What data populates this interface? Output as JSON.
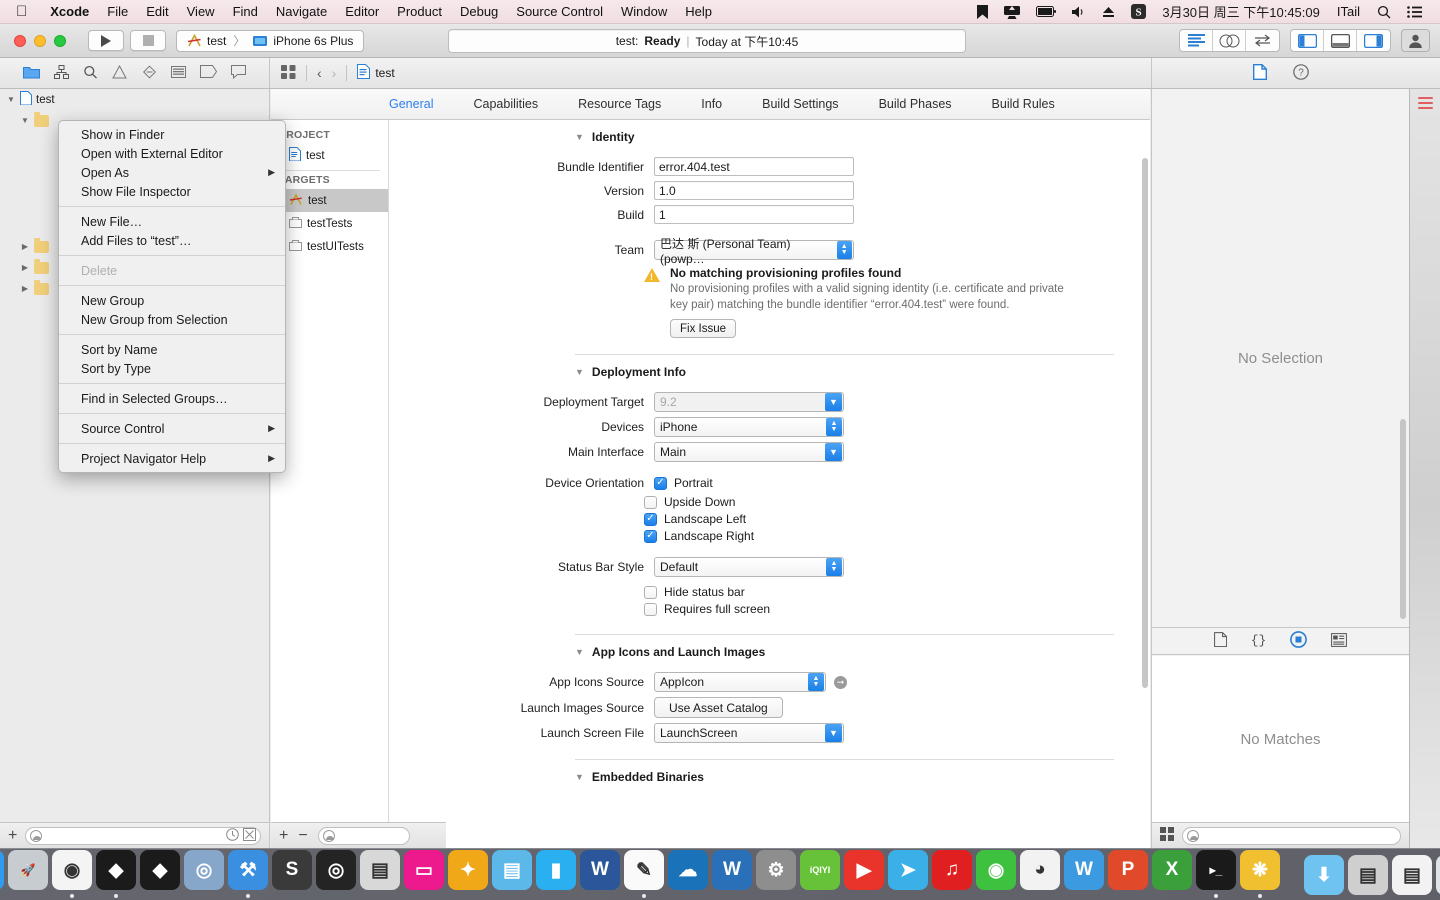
{
  "menubar": {
    "apple": "apple-logo",
    "items": [
      "Xcode",
      "File",
      "Edit",
      "View",
      "Find",
      "Navigate",
      "Editor",
      "Product",
      "Debug",
      "Source Control",
      "Window",
      "Help"
    ],
    "app_name": "Xcode",
    "status_icons": [
      "bookmark-icon",
      "screen-share-icon",
      "battery-icon",
      "volume-icon",
      "eject-icon"
    ],
    "input_method": "S",
    "clock": "3月30日 周三 下午10:45:09",
    "user": "ITail",
    "search_icon": "search-icon",
    "notification_icon": "notification-center-icon"
  },
  "toolbar": {
    "run_label": "run-button",
    "stop_label": "stop-button",
    "scheme_name": "test",
    "scheme_separator": "〉",
    "destination": "iPhone 6s Plus",
    "status_project": "test:",
    "status_state": "Ready",
    "status_divider": "|",
    "status_time": "Today at 下午10:45",
    "editor_modes": [
      "standard-editor",
      "assistant-editor",
      "version-editor"
    ],
    "view_toggles": [
      "navigator-toggle",
      "debug-area-toggle",
      "utilities-toggle"
    ],
    "account_icon": "person-icon"
  },
  "navigator_toolbar": {
    "icons": [
      "project-navigator-icon",
      "symbol-navigator-icon",
      "find-navigator-icon",
      "issue-navigator-icon",
      "test-navigator-icon",
      "debug-navigator-icon",
      "breakpoint-navigator-icon",
      "report-navigator-icon"
    ]
  },
  "jumpbar": {
    "grid_icon": "related-items-icon",
    "back": "‹",
    "forward": "›",
    "crumb_icon": "project-file-icon",
    "crumb": "test"
  },
  "inspector_tabs": {
    "items": [
      "file-inspector-icon",
      "quick-help-icon"
    ],
    "selected": 0
  },
  "navigator": {
    "rows": [
      {
        "indent": 0,
        "caret": "▼",
        "icon": "project-file-icon",
        "label": "test"
      },
      {
        "indent": 1,
        "caret": "▼",
        "icon": "folder-yellow-icon",
        "label": ""
      },
      {
        "indent": 2,
        "caret": "",
        "icon": "",
        "label": ""
      },
      {
        "indent": 2,
        "caret": "",
        "icon": "",
        "label": ""
      },
      {
        "indent": 2,
        "caret": "",
        "icon": "",
        "label": ""
      },
      {
        "indent": 2,
        "caret": "",
        "icon": "",
        "label": ""
      },
      {
        "indent": 2,
        "caret": "",
        "icon": "",
        "label": ""
      },
      {
        "indent": 1,
        "caret": "▶",
        "icon": "folder-yellow-icon",
        "label": ""
      },
      {
        "indent": 1,
        "caret": "▶",
        "icon": "folder-yellow-icon",
        "label": ""
      },
      {
        "indent": 1,
        "caret": "▶",
        "icon": "folder-yellow-icon",
        "label": ""
      }
    ],
    "filter_placeholder": "",
    "add_label": "+",
    "history_icon": "recent-files-icon",
    "filter_icon": "filter-icon"
  },
  "context_menu": {
    "groups": [
      [
        {
          "label": "Show in Finder",
          "submenu": false,
          "disabled": false
        },
        {
          "label": "Open with External Editor",
          "submenu": false,
          "disabled": false
        },
        {
          "label": "Open As",
          "submenu": true,
          "disabled": false
        },
        {
          "label": "Show File Inspector",
          "submenu": false,
          "disabled": false
        }
      ],
      [
        {
          "label": "New File…",
          "submenu": false,
          "disabled": false
        },
        {
          "label": "Add Files to “test”…",
          "submenu": false,
          "disabled": false
        }
      ],
      [
        {
          "label": "Delete",
          "submenu": false,
          "disabled": true
        }
      ],
      [
        {
          "label": "New Group",
          "submenu": false,
          "disabled": false
        },
        {
          "label": "New Group from Selection",
          "submenu": false,
          "disabled": false
        }
      ],
      [
        {
          "label": "Sort by Name",
          "submenu": false,
          "disabled": false
        },
        {
          "label": "Sort by Type",
          "submenu": false,
          "disabled": false
        }
      ],
      [
        {
          "label": "Find in Selected Groups…",
          "submenu": false,
          "disabled": false
        }
      ],
      [
        {
          "label": "Source Control",
          "submenu": true,
          "disabled": false
        }
      ],
      [
        {
          "label": "Project Navigator Help",
          "submenu": true,
          "disabled": false
        }
      ]
    ]
  },
  "editor": {
    "tabs": [
      {
        "label": "General",
        "active": true
      },
      {
        "label": "Capabilities",
        "active": false
      },
      {
        "label": "Resource Tags",
        "active": false
      },
      {
        "label": "Info",
        "active": false
      },
      {
        "label": "Build Settings",
        "active": false
      },
      {
        "label": "Build Phases",
        "active": false
      },
      {
        "label": "Build Rules",
        "active": false
      }
    ],
    "project_header": "PROJECT",
    "project_item": "test",
    "targets_header": "TARGETS",
    "targets": [
      {
        "label": "test",
        "icon": "app-target-icon",
        "selected": true
      },
      {
        "label": "testTests",
        "icon": "test-bundle-icon",
        "selected": false
      },
      {
        "label": "testUITests",
        "icon": "test-bundle-icon",
        "selected": false
      }
    ],
    "add_label": "+",
    "remove_label": "−",
    "filter_placeholder": ""
  },
  "identity": {
    "title": "Identity",
    "bundle_identifier_label": "Bundle Identifier",
    "bundle_identifier": "error.404.test",
    "version_label": "Version",
    "version": "1.0",
    "build_label": "Build",
    "build": "1",
    "team_label": "Team",
    "team": "巴达 斯 (Personal Team) (powp…"
  },
  "warning": {
    "title": "No matching provisioning profiles found",
    "body": "No provisioning profiles with a valid signing identity (i.e. certificate and private key pair) matching the bundle identifier “error.404.test” were found.",
    "fix_button": "Fix Issue",
    "icon": "warning-triangle-icon"
  },
  "deployment": {
    "title": "Deployment Info",
    "deployment_target_label": "Deployment Target",
    "deployment_target": "9.2",
    "devices_label": "Devices",
    "devices": "iPhone",
    "main_interface_label": "Main Interface",
    "main_interface": "Main",
    "device_orientation_label": "Device Orientation",
    "orientations": [
      {
        "label": "Portrait",
        "checked": true
      },
      {
        "label": "Upside Down",
        "checked": false
      },
      {
        "label": "Landscape Left",
        "checked": true
      },
      {
        "label": "Landscape Right",
        "checked": true
      }
    ],
    "status_bar_style_label": "Status Bar Style",
    "status_bar_style": "Default",
    "extra_checks": [
      {
        "label": "Hide status bar",
        "checked": false
      },
      {
        "label": "Requires full screen",
        "checked": false
      }
    ]
  },
  "app_icons": {
    "title": "App Icons and Launch Images",
    "app_icons_source_label": "App Icons Source",
    "app_icons_source": "AppIcon",
    "launch_images_source_label": "Launch Images Source",
    "launch_images_button": "Use Asset Catalog",
    "launch_screen_file_label": "Launch Screen File",
    "launch_screen_file": "LaunchScreen",
    "goto_icon": "arrow-right-circle-icon"
  },
  "embedded": {
    "title": "Embedded Binaries"
  },
  "utilities": {
    "inspector_empty": "No Selection",
    "library_tabs": [
      "file-template-library-icon",
      "code-snippet-library-icon",
      "object-library-icon",
      "media-library-icon"
    ],
    "library_selected": 2,
    "library_empty": "No Matches",
    "filter_placeholder": "",
    "grid_icon": "library-grid-icon"
  },
  "dock": {
    "items": [
      {
        "name": "finder",
        "label": "☺",
        "bg": "#2e9cf0",
        "running": true
      },
      {
        "name": "launchpad",
        "label": "🚀",
        "bg": "#c7ccd1",
        "running": false
      },
      {
        "name": "google-chrome",
        "label": "◉",
        "bg": "#f4f4f4",
        "running": true
      },
      {
        "name": "unity",
        "label": "◆",
        "bg": "#1b1b1b",
        "running": true
      },
      {
        "name": "unity-hub",
        "label": "◆",
        "bg": "#1b1b1b",
        "running": false
      },
      {
        "name": "rider",
        "label": "◎",
        "bg": "#86a7c9",
        "running": false
      },
      {
        "name": "xcode",
        "label": "⚒",
        "bg": "#3b8fe0",
        "running": true
      },
      {
        "name": "sublime-text",
        "label": "S",
        "bg": "#3a3a3a",
        "running": false
      },
      {
        "name": "photo-booth",
        "label": "◎",
        "bg": "#242424",
        "running": false
      },
      {
        "name": "image-capture",
        "label": "▤",
        "bg": "#d8d8d8",
        "running": false
      },
      {
        "name": "display",
        "label": "▭",
        "bg": "#ec1a8d",
        "running": false
      },
      {
        "name": "butterfly-app",
        "label": "✦",
        "bg": "#f0a818",
        "running": false
      },
      {
        "name": "keynote",
        "label": "▤",
        "bg": "#5bb8e8",
        "running": false
      },
      {
        "name": "ibooks",
        "label": "▮",
        "bg": "#2ab0f0",
        "running": false
      },
      {
        "name": "microsoft-word",
        "label": "W",
        "bg": "#2b579a",
        "running": false
      },
      {
        "name": "notes",
        "label": "✎",
        "bg": "#fafafa",
        "running": true
      },
      {
        "name": "openoffice",
        "label": "☁",
        "bg": "#1a72b8",
        "running": false
      },
      {
        "name": "wps-writer",
        "label": "W",
        "bg": "#2a70b8",
        "running": false
      },
      {
        "name": "system-preferences",
        "label": "⚙",
        "bg": "#8e8e8e",
        "running": false
      },
      {
        "name": "iqiyi",
        "label": "iQIYI",
        "bg": "#67c23a",
        "running": false
      },
      {
        "name": "media-player",
        "label": "▶",
        "bg": "#e8342b",
        "running": false
      },
      {
        "name": "hummingbird-app",
        "label": "➤",
        "bg": "#3bb0e8",
        "running": false
      },
      {
        "name": "netease-music",
        "label": "♫",
        "bg": "#e02020",
        "running": false
      },
      {
        "name": "wechat",
        "label": "◉",
        "bg": "#3ec13e",
        "running": false
      },
      {
        "name": "qq",
        "label": "◕",
        "bg": "#f2f2f2",
        "running": false
      },
      {
        "name": "wps-w",
        "label": "W",
        "bg": "#3b9ae0",
        "running": false
      },
      {
        "name": "wps-presentation",
        "label": "P",
        "bg": "#e04a2a",
        "running": false
      },
      {
        "name": "wps-spreadsheet",
        "label": "X",
        "bg": "#3ba03b",
        "running": false
      },
      {
        "name": "terminal",
        "label": "▸_",
        "bg": "#1a1a1a",
        "running": true
      },
      {
        "name": "color-wheel-app",
        "label": "❋",
        "bg": "#f0c030",
        "running": true
      }
    ],
    "right_items": [
      {
        "name": "downloads-folder",
        "label": "⬇",
        "bg": "#6fc3f0"
      },
      {
        "name": "unity-project-stack",
        "label": "▤",
        "bg": "#cfcfcf"
      },
      {
        "name": "documents-stack",
        "label": "▤",
        "bg": "#f2f2f2"
      },
      {
        "name": "trash",
        "label": "🗑",
        "bg": "#dfe4e8"
      }
    ]
  }
}
